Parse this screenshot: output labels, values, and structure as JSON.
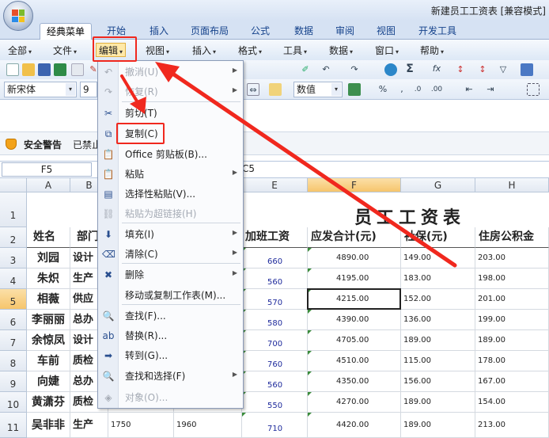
{
  "window": {
    "title": "新建员工工资表 [兼容模式]"
  },
  "ribbon_tabs": [
    "经典菜单",
    "开始",
    "插入",
    "页面布局",
    "公式",
    "数据",
    "审阅",
    "视图",
    "开发工具"
  ],
  "menus": [
    "全部",
    "文件",
    "编辑",
    "视图",
    "插入",
    "格式",
    "工具",
    "数据",
    "窗口",
    "帮助"
  ],
  "toolbar": {
    "font_name": "新宋体",
    "font_size": "9",
    "number_format": "数值"
  },
  "security_bar": {
    "title": "安全警告",
    "message": "已禁止"
  },
  "formula_bar": {
    "name_box": "F5",
    "formula_fragment": "C5"
  },
  "edit_menu": {
    "items": [
      {
        "label": "撤消(U)",
        "icon": "undo-icon",
        "glyph": "↶",
        "disabled": true,
        "submenu": true
      },
      {
        "label": "恢复(R)",
        "icon": "redo-icon",
        "glyph": "↷",
        "disabled": true,
        "submenu": true
      },
      {
        "label": "剪切(T)",
        "icon": "scissors-icon",
        "glyph": "✂",
        "disabled": false,
        "submenu": false
      },
      {
        "label": "复制(C)",
        "icon": "copy-icon",
        "glyph": "⧉",
        "disabled": false,
        "submenu": false
      },
      {
        "label": "Office 剪贴板(B)...",
        "icon": "clipboard-icon",
        "glyph": "📋",
        "disabled": false,
        "submenu": false
      },
      {
        "label": "粘贴",
        "icon": "paste-icon",
        "glyph": "📋",
        "disabled": false,
        "submenu": true
      },
      {
        "label": "选择性粘贴(V)...",
        "icon": "paste-special-icon",
        "glyph": "▤",
        "disabled": false,
        "submenu": false
      },
      {
        "label": "粘贴为超链接(H)",
        "icon": "paste-link-icon",
        "glyph": "⛓",
        "disabled": true,
        "submenu": false
      },
      {
        "label": "填充(I)",
        "icon": "fill-icon",
        "glyph": "⬇",
        "disabled": false,
        "submenu": true
      },
      {
        "label": "清除(C)",
        "icon": "eraser-icon",
        "glyph": "⌫",
        "disabled": false,
        "submenu": true
      },
      {
        "label": "删除",
        "icon": "delete-icon",
        "glyph": "✖",
        "disabled": false,
        "submenu": true
      },
      {
        "label": "移动或复制工作表(M)...",
        "icon": "",
        "glyph": "",
        "disabled": false,
        "submenu": false
      },
      {
        "label": "查找(F)...",
        "icon": "binoculars-icon",
        "glyph": "🔍",
        "disabled": false,
        "submenu": false
      },
      {
        "label": "替换(R)...",
        "icon": "replace-icon",
        "glyph": "ab",
        "disabled": false,
        "submenu": false
      },
      {
        "label": "转到(G)...",
        "icon": "goto-arrow-icon",
        "glyph": "➡",
        "disabled": false,
        "submenu": false
      },
      {
        "label": "查找和选择(F)",
        "icon": "find-select-icon",
        "glyph": "🔍",
        "disabled": false,
        "submenu": true
      },
      {
        "label": "对象(O)...",
        "icon": "object-icon",
        "glyph": "◈",
        "disabled": true,
        "submenu": false
      }
    ]
  },
  "sheet": {
    "columns": [
      "A",
      "B",
      "C",
      "D",
      "E",
      "F",
      "G",
      "H"
    ],
    "rows": [
      "1",
      "2",
      "3",
      "4",
      "5",
      "6",
      "7",
      "8",
      "9",
      "10",
      "11"
    ],
    "selected_column": "F",
    "selected_row": "5",
    "title": "员工工资表",
    "headers": [
      "姓名",
      "部门",
      "",
      "",
      "加班工资",
      "应发合计(元)",
      "社保(元)",
      "住房公积金"
    ],
    "data": [
      [
        "刘园",
        "设计",
        "",
        "",
        "660",
        "4890.00",
        "149.00",
        "203.00"
      ],
      [
        "朱炽",
        "生产",
        "",
        "",
        "560",
        "4195.00",
        "183.00",
        "198.00"
      ],
      [
        "相薇",
        "供应",
        "",
        "",
        "570",
        "4215.00",
        "152.00",
        "201.00"
      ],
      [
        "李丽丽",
        "总办",
        "",
        "",
        "580",
        "4390.00",
        "136.00",
        "199.00"
      ],
      [
        "余惊凤",
        "设计",
        "",
        "",
        "700",
        "4705.00",
        "189.00",
        "189.00"
      ],
      [
        "车前",
        "质检",
        "",
        "",
        "760",
        "4510.00",
        "115.00",
        "178.00"
      ],
      [
        "向婕",
        "总办",
        "",
        "",
        "560",
        "4350.00",
        "156.00",
        "167.00"
      ],
      [
        "黄潇芬",
        "质检",
        "1650",
        "1920",
        "550",
        "4270.00",
        "189.00",
        "154.00"
      ],
      [
        "吴非非",
        "生产",
        "1750",
        "1960",
        "710",
        "4420.00",
        "189.00",
        "213.00"
      ]
    ]
  },
  "annotation_color": "#f0281e"
}
